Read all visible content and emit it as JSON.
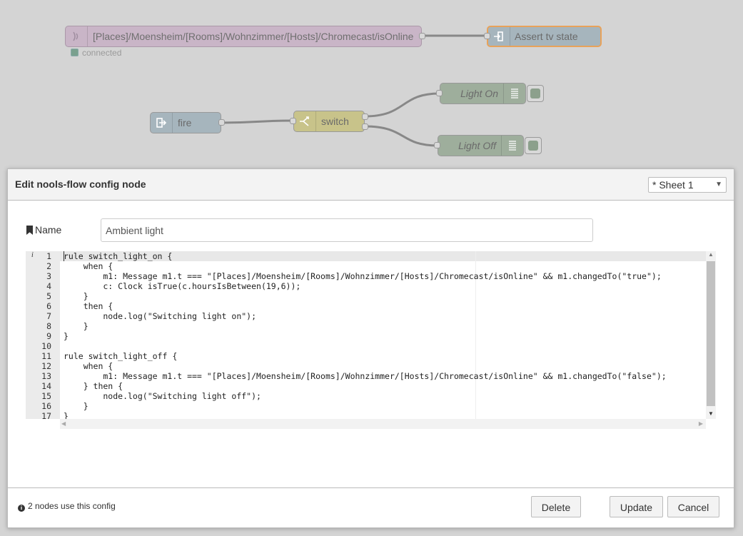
{
  "flow": {
    "mqtt_node": {
      "label": "[Places]/Moensheim/[Rooms]/Wohnzimmer/[Hosts]/Chromecast/isOnline",
      "icon": "radio-waves-icon",
      "status": "connected",
      "status_color": "#7aa08e"
    },
    "assert_node": {
      "label": "Assert tv state",
      "icon": "link-in-icon",
      "color": "#a6bbcf",
      "border": "#ff7f0e"
    },
    "inject_node": {
      "label": "fire",
      "icon": "arrow-in-icon",
      "color": "#a6bbcf"
    },
    "switch_node": {
      "label": "switch",
      "icon": "switch-icon",
      "color": "#e2d96e"
    },
    "light_on_node": {
      "label": "Light On",
      "icon": "list-icon",
      "color": "#87a980"
    },
    "light_off_node": {
      "label": "Light Off",
      "icon": "list-icon",
      "color": "#87a980"
    }
  },
  "dialog": {
    "title": "Edit nools-flow config node",
    "sheet_select": "* Sheet 1",
    "name_label": "Name",
    "name_icon": "tag-icon",
    "name_value": "Ambient light",
    "editor": {
      "line_numbers": [
        "1",
        "2",
        "3",
        "4",
        "5",
        "6",
        "7",
        "8",
        "9",
        "10",
        "11",
        "12",
        "13",
        "14",
        "15",
        "16",
        "17"
      ],
      "lines": [
        "rule switch_light_on {",
        "    when {",
        "        m1: Message m1.t === \"[Places]/Moensheim/[Rooms]/Wohnzimmer/[Hosts]/Chromecast/isOnline\" && m1.changedTo(\"true\");",
        "        c: Clock isTrue(c.hoursIsBetween(19,6));",
        "    }",
        "    then {",
        "        node.log(\"Switching light on\");",
        "    }",
        "}",
        "",
        "rule switch_light_off {",
        "    when {",
        "        m1: Message m1.t === \"[Places]/Moensheim/[Rooms]/Wohnzimmer/[Hosts]/Chromecast/isOnline\" && m1.changedTo(\"false\");",
        "    } then {",
        "        node.log(\"Switching light off\");",
        "    }",
        "}"
      ],
      "gutter_info": "i"
    },
    "usage_text": "2 nodes use this config",
    "delete_label": "Delete",
    "update_label": "Update",
    "cancel_label": "Cancel"
  }
}
